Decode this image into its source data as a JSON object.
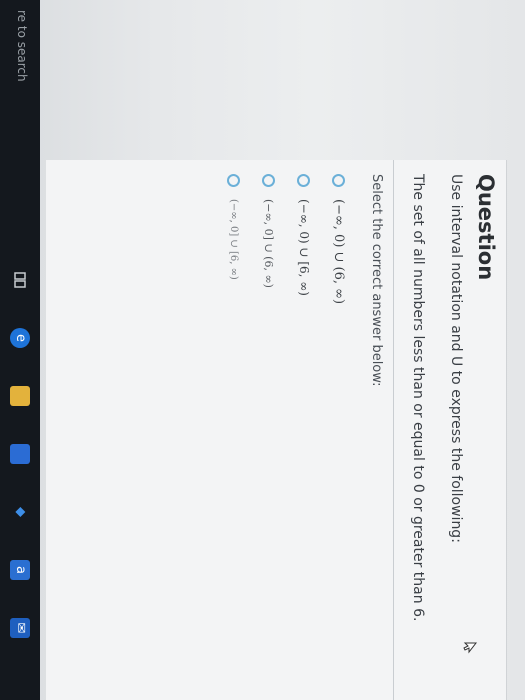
{
  "taskbar": {
    "search_text": "re to search",
    "icons": [
      "task-view-icon",
      "edge-browser-icon",
      "file-explorer-icon",
      "store-icon",
      "dropbox-icon",
      "amazon-icon",
      "mail-icon"
    ]
  },
  "question": {
    "title": "Question",
    "instruction": "Use interval notation and U to express the following:",
    "prompt": "The set of all numbers less than or equal to 0 or greater than 6.",
    "select_label": "Select the correct answer below:",
    "options": [
      {
        "label": "(−∞, 0) ∪ (6, ∞)"
      },
      {
        "label": "(−∞, 0) ∪ [6, ∞)"
      },
      {
        "label": "(−∞, 0] ∪ (6, ∞)"
      },
      {
        "label": "(−∞, 0] ∪ [6, ∞)"
      }
    ]
  },
  "colors": {
    "radio_border": "#6bb0d8",
    "card_bg": "#f3f4f5",
    "taskbar_bg": "#14181e"
  }
}
